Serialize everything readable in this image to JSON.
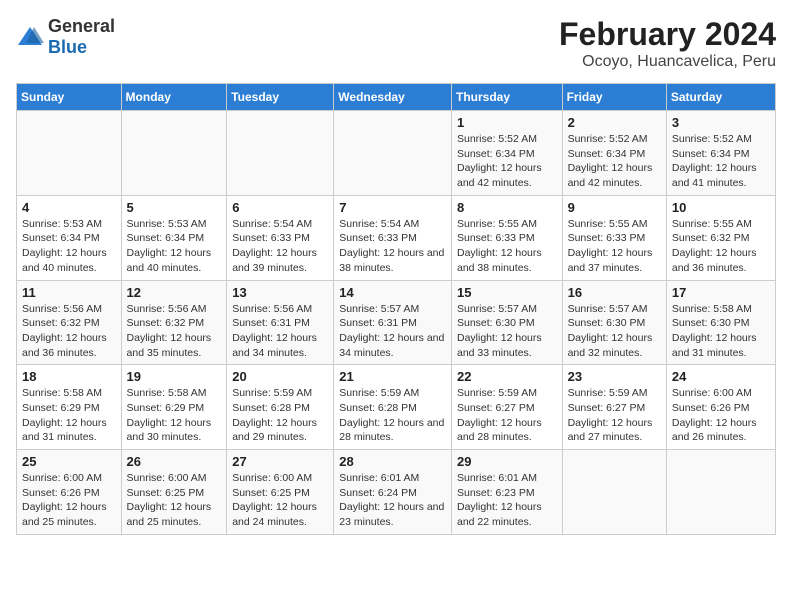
{
  "logo": {
    "general": "General",
    "blue": "Blue"
  },
  "header": {
    "title": "February 2024",
    "subtitle": "Ocoyo, Huancavelica, Peru"
  },
  "columns": [
    "Sunday",
    "Monday",
    "Tuesday",
    "Wednesday",
    "Thursday",
    "Friday",
    "Saturday"
  ],
  "weeks": [
    [
      {
        "day": "",
        "info": ""
      },
      {
        "day": "",
        "info": ""
      },
      {
        "day": "",
        "info": ""
      },
      {
        "day": "",
        "info": ""
      },
      {
        "day": "1",
        "info": "Sunrise: 5:52 AM\nSunset: 6:34 PM\nDaylight: 12 hours and 42 minutes."
      },
      {
        "day": "2",
        "info": "Sunrise: 5:52 AM\nSunset: 6:34 PM\nDaylight: 12 hours and 42 minutes."
      },
      {
        "day": "3",
        "info": "Sunrise: 5:52 AM\nSunset: 6:34 PM\nDaylight: 12 hours and 41 minutes."
      }
    ],
    [
      {
        "day": "4",
        "info": "Sunrise: 5:53 AM\nSunset: 6:34 PM\nDaylight: 12 hours and 40 minutes."
      },
      {
        "day": "5",
        "info": "Sunrise: 5:53 AM\nSunset: 6:34 PM\nDaylight: 12 hours and 40 minutes."
      },
      {
        "day": "6",
        "info": "Sunrise: 5:54 AM\nSunset: 6:33 PM\nDaylight: 12 hours and 39 minutes."
      },
      {
        "day": "7",
        "info": "Sunrise: 5:54 AM\nSunset: 6:33 PM\nDaylight: 12 hours and 38 minutes."
      },
      {
        "day": "8",
        "info": "Sunrise: 5:55 AM\nSunset: 6:33 PM\nDaylight: 12 hours and 38 minutes."
      },
      {
        "day": "9",
        "info": "Sunrise: 5:55 AM\nSunset: 6:33 PM\nDaylight: 12 hours and 37 minutes."
      },
      {
        "day": "10",
        "info": "Sunrise: 5:55 AM\nSunset: 6:32 PM\nDaylight: 12 hours and 36 minutes."
      }
    ],
    [
      {
        "day": "11",
        "info": "Sunrise: 5:56 AM\nSunset: 6:32 PM\nDaylight: 12 hours and 36 minutes."
      },
      {
        "day": "12",
        "info": "Sunrise: 5:56 AM\nSunset: 6:32 PM\nDaylight: 12 hours and 35 minutes."
      },
      {
        "day": "13",
        "info": "Sunrise: 5:56 AM\nSunset: 6:31 PM\nDaylight: 12 hours and 34 minutes."
      },
      {
        "day": "14",
        "info": "Sunrise: 5:57 AM\nSunset: 6:31 PM\nDaylight: 12 hours and 34 minutes."
      },
      {
        "day": "15",
        "info": "Sunrise: 5:57 AM\nSunset: 6:30 PM\nDaylight: 12 hours and 33 minutes."
      },
      {
        "day": "16",
        "info": "Sunrise: 5:57 AM\nSunset: 6:30 PM\nDaylight: 12 hours and 32 minutes."
      },
      {
        "day": "17",
        "info": "Sunrise: 5:58 AM\nSunset: 6:30 PM\nDaylight: 12 hours and 31 minutes."
      }
    ],
    [
      {
        "day": "18",
        "info": "Sunrise: 5:58 AM\nSunset: 6:29 PM\nDaylight: 12 hours and 31 minutes."
      },
      {
        "day": "19",
        "info": "Sunrise: 5:58 AM\nSunset: 6:29 PM\nDaylight: 12 hours and 30 minutes."
      },
      {
        "day": "20",
        "info": "Sunrise: 5:59 AM\nSunset: 6:28 PM\nDaylight: 12 hours and 29 minutes."
      },
      {
        "day": "21",
        "info": "Sunrise: 5:59 AM\nSunset: 6:28 PM\nDaylight: 12 hours and 28 minutes."
      },
      {
        "day": "22",
        "info": "Sunrise: 5:59 AM\nSunset: 6:27 PM\nDaylight: 12 hours and 28 minutes."
      },
      {
        "day": "23",
        "info": "Sunrise: 5:59 AM\nSunset: 6:27 PM\nDaylight: 12 hours and 27 minutes."
      },
      {
        "day": "24",
        "info": "Sunrise: 6:00 AM\nSunset: 6:26 PM\nDaylight: 12 hours and 26 minutes."
      }
    ],
    [
      {
        "day": "25",
        "info": "Sunrise: 6:00 AM\nSunset: 6:26 PM\nDaylight: 12 hours and 25 minutes."
      },
      {
        "day": "26",
        "info": "Sunrise: 6:00 AM\nSunset: 6:25 PM\nDaylight: 12 hours and 25 minutes."
      },
      {
        "day": "27",
        "info": "Sunrise: 6:00 AM\nSunset: 6:25 PM\nDaylight: 12 hours and 24 minutes."
      },
      {
        "day": "28",
        "info": "Sunrise: 6:01 AM\nSunset: 6:24 PM\nDaylight: 12 hours and 23 minutes."
      },
      {
        "day": "29",
        "info": "Sunrise: 6:01 AM\nSunset: 6:23 PM\nDaylight: 12 hours and 22 minutes."
      },
      {
        "day": "",
        "info": ""
      },
      {
        "day": "",
        "info": ""
      }
    ]
  ]
}
